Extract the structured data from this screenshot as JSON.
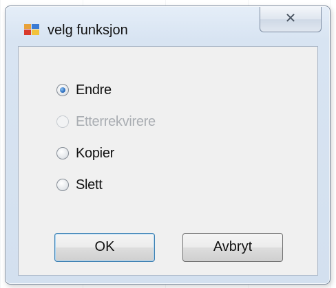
{
  "window": {
    "title": "velg funksjon",
    "close_glyph": "✕"
  },
  "icons": {
    "app": "app-window-icon",
    "close": "close-icon"
  },
  "options": [
    {
      "label": "Endre",
      "checked": true,
      "disabled": false
    },
    {
      "label": "Etterrekvirere",
      "checked": false,
      "disabled": true
    },
    {
      "label": "Kopier",
      "checked": false,
      "disabled": false
    },
    {
      "label": "Slett",
      "checked": false,
      "disabled": false
    }
  ],
  "buttons": {
    "ok": "OK",
    "cancel": "Avbryt"
  },
  "colors": {
    "dialog_frame": "#d3e0ef",
    "client": "#f0f0f0",
    "radio_dot": "#2d6fc0"
  }
}
